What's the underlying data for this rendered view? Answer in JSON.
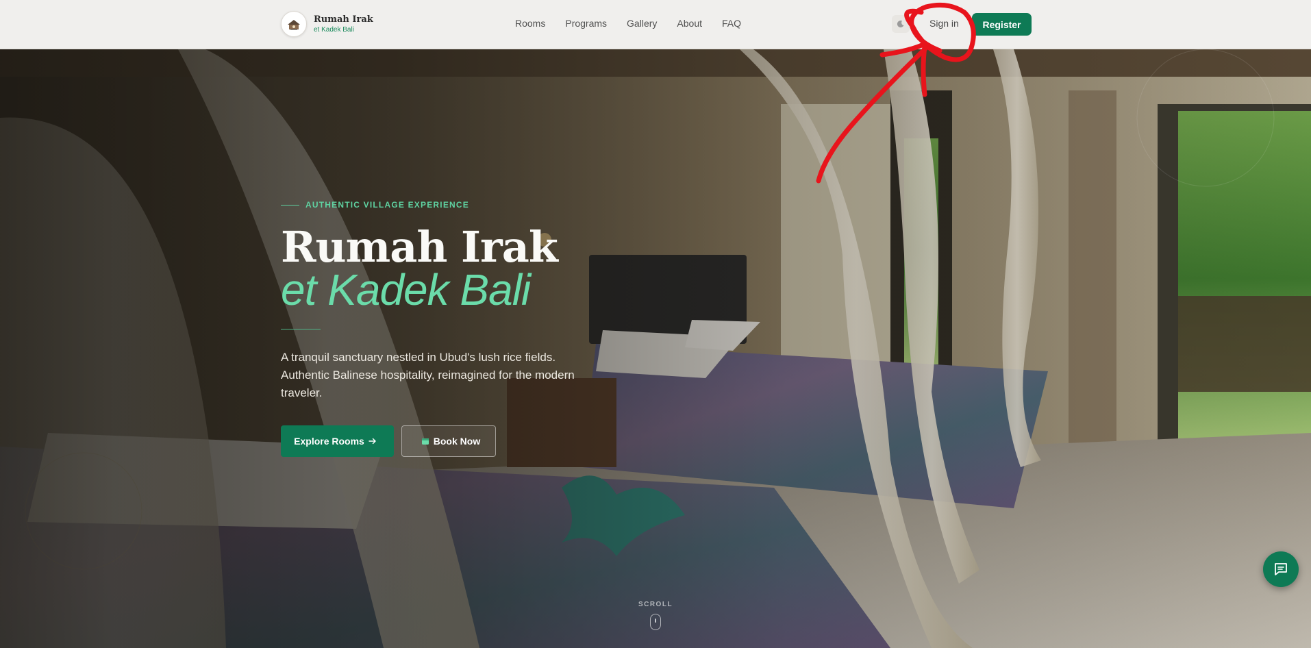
{
  "brand": {
    "name": "Rumah Irak",
    "subtitle": "et Kadek Bali"
  },
  "nav": {
    "links": [
      "Rooms",
      "Programs",
      "Gallery",
      "About",
      "FAQ"
    ],
    "theme_toggle_icon": "moon-icon",
    "signin_label": "Sign in",
    "register_label": "Register"
  },
  "hero": {
    "eyebrow": "AUTHENTIC VILLAGE EXPERIENCE",
    "title": "Rumah Irak",
    "subtitle": "et Kadek Bali",
    "description": "A tranquil sanctuary nestled in Ubud's lush rice fields. Authentic Balinese hospitality, reimagined for the modern traveler.",
    "primary_cta": "Explore Rooms",
    "secondary_cta": "Book Now",
    "scroll_label": "SCROLL"
  },
  "chat": {
    "icon": "chat-icon"
  },
  "colors": {
    "accent": "#0e7a55",
    "accent_light": "#6bdcaa",
    "navbar_bg": "#f0efed",
    "annotation": "#e8141c"
  }
}
